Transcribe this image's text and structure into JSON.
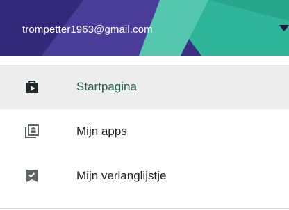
{
  "drawer": {
    "account_email": "trompetter1963@gmail.com",
    "account_toggle_icon": "chevron-down-icon",
    "items": [
      {
        "label": "Startpagina",
        "icon": "store-bag-icon",
        "selected": true
      },
      {
        "label": "Mijn apps",
        "icon": "my-apps-icon",
        "selected": false
      },
      {
        "label": "Mijn verlanglijstje",
        "icon": "wishlist-bookmark-icon",
        "selected": false
      }
    ]
  },
  "colors": {
    "header_purple": "#3a2e86",
    "header_teal": "#2fb69a",
    "selected_bg": "#ededed",
    "icon_grey": "#5f6368"
  }
}
